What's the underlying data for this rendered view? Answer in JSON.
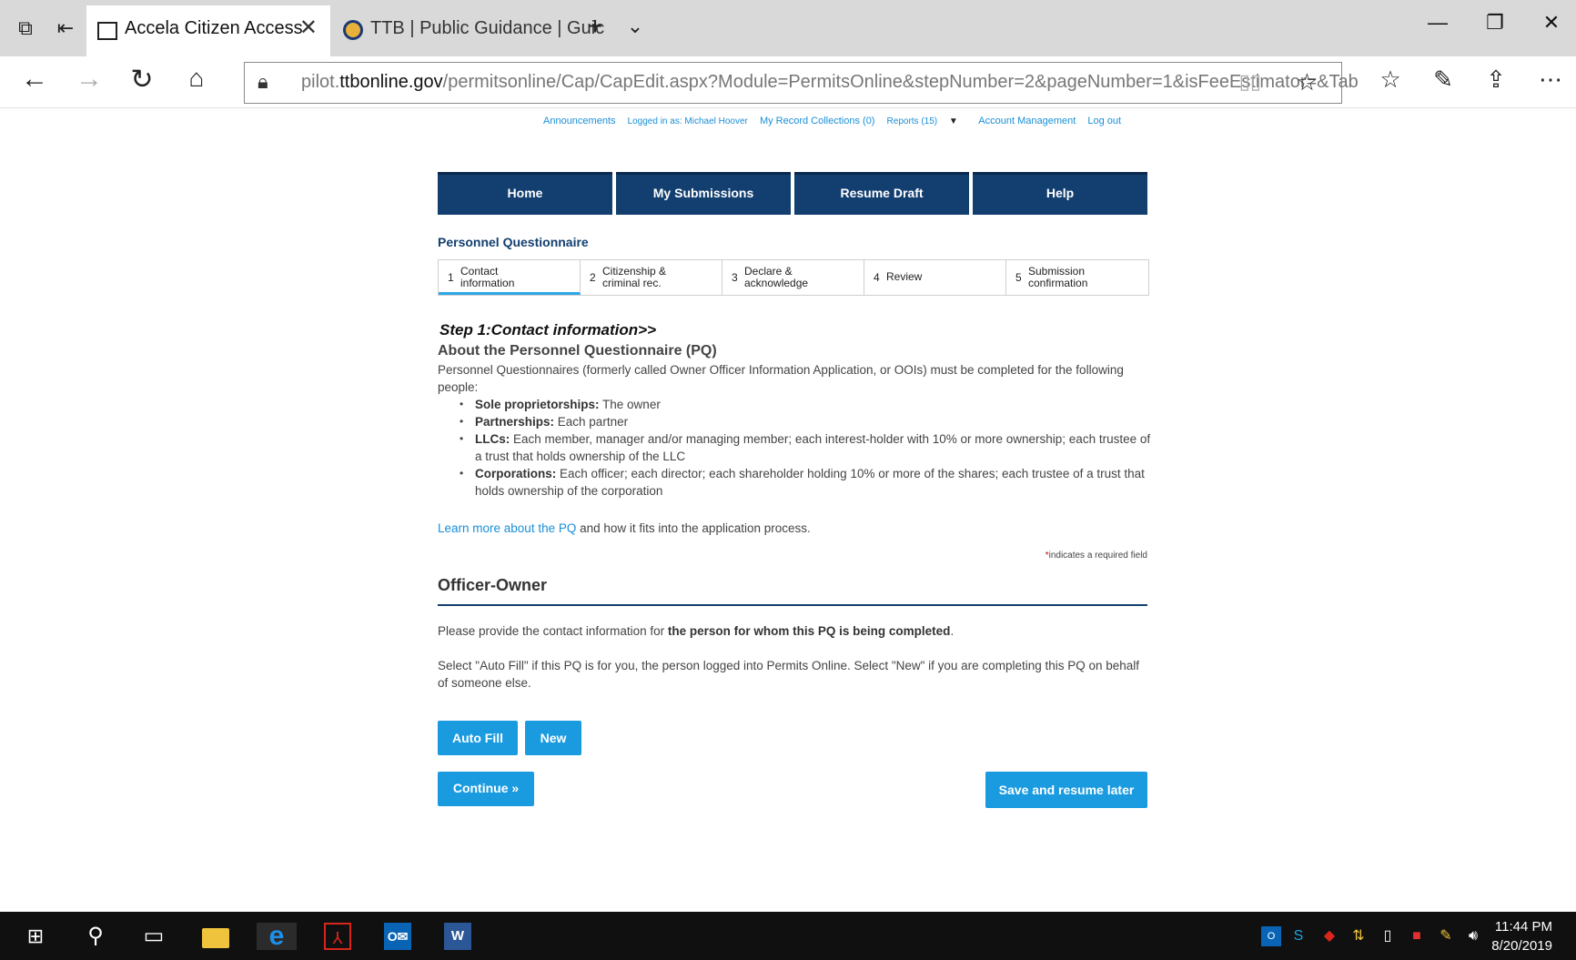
{
  "browser": {
    "tabs": [
      {
        "title": "Accela Citizen Access",
        "active": true
      },
      {
        "title": "TTB | Public Guidance | Guic",
        "active": false
      }
    ],
    "new_tab_icon": "plus-icon",
    "url_prefix": "pilot.",
    "url_domain": "ttbonline.gov",
    "url_path": "/permitsonline/Cap/CapEdit.aspx?Module=PermitsOnline&stepNumber=2&pageNumber=1&isFeeEstimator=&Tab"
  },
  "topnav": {
    "announcements": "Announcements",
    "logged_in": "Logged in as: Michael Hoover",
    "collections": "My Record Collections (0)",
    "reports": "Reports (15)",
    "account": "Account Management",
    "logout": "Log out"
  },
  "mainnav": [
    "Home",
    "My Submissions",
    "Resume Draft",
    "Help"
  ],
  "section_title": "Personnel Questionnaire",
  "steps": [
    {
      "num": "1",
      "label_1": "Contact",
      "label_2": "information",
      "active": true
    },
    {
      "num": "2",
      "label_1": "Citizenship &",
      "label_2": "criminal rec.",
      "active": false
    },
    {
      "num": "3",
      "label_1": "Declare &",
      "label_2": "acknowledge",
      "active": false
    },
    {
      "num": "4",
      "label_1": "Review",
      "label_2": "",
      "active": false
    },
    {
      "num": "5",
      "label_1": "Submission",
      "label_2": "confirmation",
      "active": false
    }
  ],
  "step_heading": "Step 1:Contact information>>",
  "about": {
    "title": "About the Personnel Questionnaire (PQ)",
    "intro": "Personnel Questionnaires (formerly called Owner Officer Information Application, or OOIs) must be completed for the following people:",
    "bullets": [
      {
        "bold": "Sole proprietorships:",
        "text": " The owner"
      },
      {
        "bold": "Partnerships:",
        "text": " Each partner"
      },
      {
        "bold": "LLCs:",
        "text": " Each member, manager and/or managing member; each interest-holder with 10% or more ownership; each trustee of a trust that holds ownership of the LLC"
      },
      {
        "bold": "Corporations:",
        "text": " Each officer; each director; each shareholder holding 10% or more of the shares; each trustee of a trust that holds ownership of the corporation"
      }
    ],
    "learn_link": "Learn more about the PQ",
    "learn_rest": " and how it fits into the application process."
  },
  "required_note_star": "*",
  "required_note": "indicates a required field",
  "officer": {
    "title": "Officer-Owner",
    "instruction_pre": "Please provide the contact information for ",
    "instruction_bold": "the person for whom this PQ is being completed",
    "instruction_post": ".",
    "select_text": "Select \"Auto Fill\" if this PQ is for you, the person logged into Permits Online.  Select \"New\" if you are completing this PQ on behalf of someone else."
  },
  "buttons": {
    "auto_fill": "Auto Fill",
    "new": "New",
    "continue": "Continue »",
    "save": "Save and resume later"
  },
  "taskbar": {
    "time": "11:44 PM",
    "date": "8/20/2019"
  }
}
